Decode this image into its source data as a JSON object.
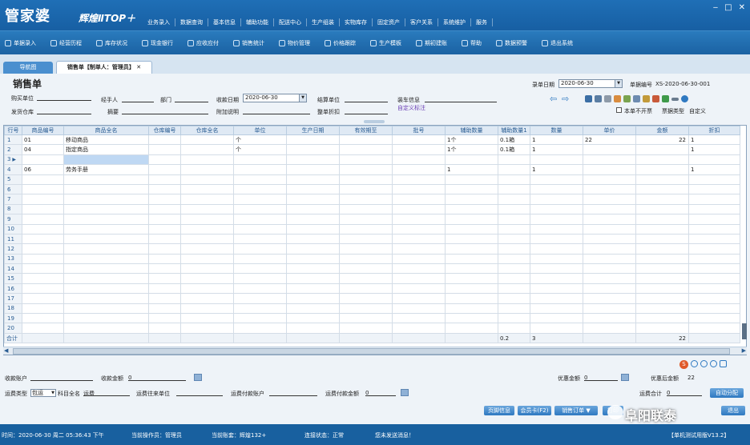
{
  "app": {
    "logo": "管家婆",
    "edition": "辉煌ⅡTOP＋",
    "top_menu": [
      "业务录入",
      "数据查询",
      "基本信息",
      "辅助功能",
      "配送中心",
      "生产组装",
      "实物库存",
      "固定资产",
      "客户关系",
      "系统维护",
      "服务"
    ],
    "window_controls": [
      "‒",
      "□",
      "✕"
    ]
  },
  "toolbar": [
    {
      "label": "单据录入",
      "icon": "doc-icon"
    },
    {
      "label": "经营历程",
      "icon": "chart-icon"
    },
    {
      "label": "库存状况",
      "icon": "box-icon"
    },
    {
      "label": "现金银行",
      "icon": "bank-icon"
    },
    {
      "label": "应收应付",
      "icon": "money-icon"
    },
    {
      "label": "销售统计",
      "icon": "search-icon"
    },
    {
      "label": "物价管理",
      "icon": "gear-icon"
    },
    {
      "label": "价格跟踪",
      "icon": "track-icon"
    },
    {
      "label": "生产模板",
      "icon": "wrench-icon"
    },
    {
      "label": "期初建账",
      "icon": "book-icon"
    },
    {
      "label": "帮助",
      "icon": "help-icon"
    },
    {
      "label": "数据预警",
      "icon": "alert-icon"
    },
    {
      "label": "退出系统",
      "icon": "power-icon"
    }
  ],
  "tabs": {
    "nav": "导航图",
    "doc": "销售单【制单人：管理员】",
    "close": "✕"
  },
  "form": {
    "title": "销售单",
    "record_date_label": "录单日期",
    "record_date": "2020-06-30",
    "doc_no_label": "单据编号",
    "doc_no": "XS-2020-06-30-001",
    "buyer_label": "购买单位",
    "handler_label": "经手人",
    "dept_label": "部门",
    "pay_date_label": "收款日期",
    "pay_date": "2020-06-30",
    "settle_label": "结算单位",
    "loading_label": "装车信息",
    "warehouse_label": "发货仓库",
    "summary_label": "摘要",
    "note_label": "附加说明",
    "discount_label": "整单折扣",
    "custom_link": "自定义标注",
    "no_print_label": "本单不开票",
    "type_label": "票据类型",
    "custom_label": "自定义"
  },
  "grid": {
    "columns": [
      "行号",
      "商品编号",
      "商品全名",
      "仓库编号",
      "仓库全名",
      "单位",
      "生产日期",
      "有效期至",
      "批号",
      "辅助数量",
      "辅助数量1",
      "数量",
      "单价",
      "金额",
      "折扣"
    ],
    "rows": [
      [
        "1",
        "01",
        "移动商品",
        "",
        "",
        "个",
        "",
        "",
        "",
        "1个",
        "0.1箱",
        "1",
        "22",
        "22",
        "1"
      ],
      [
        "2",
        "04",
        "指定商品",
        "",
        "",
        "个",
        "",
        "",
        "",
        "1个",
        "0.1箱",
        "1",
        "",
        "",
        "1"
      ],
      [
        "3",
        "",
        "",
        "",
        "",
        "",
        "",
        "",
        "",
        "",
        "",
        "",
        "",
        "",
        ""
      ],
      [
        "4",
        "06",
        "劳务手册",
        "",
        "",
        "",
        "",
        "",
        "",
        "1",
        "",
        "1",
        "",
        "",
        "1"
      ],
      [
        "5"
      ],
      [
        "6"
      ],
      [
        "7"
      ],
      [
        "8"
      ],
      [
        "9"
      ],
      [
        "10"
      ],
      [
        "11"
      ],
      [
        "12"
      ],
      [
        "13"
      ],
      [
        "14"
      ],
      [
        "15"
      ],
      [
        "16"
      ],
      [
        "17"
      ],
      [
        "18"
      ],
      [
        "19"
      ],
      [
        "20"
      ]
    ],
    "total_label": "合计",
    "total_aux1": "0.2",
    "total_qty": "3",
    "total_amount": "22"
  },
  "bottom": {
    "account_label": "收款账户",
    "amount_label": "收款金额",
    "amount": "0",
    "discount_amount_label": "优惠金额",
    "discount_amount": "0",
    "after_discount_label": "优惠后金额",
    "after_discount": "22",
    "freight_type_label": "运费类型",
    "freight_type": "包运",
    "subject_label": "科目全名",
    "subject": "运费",
    "freight_unit_label": "运费往来单位",
    "freight_account_label": "运费付款账户",
    "freight_pay_label": "运费付款金额",
    "freight_pay": "0",
    "freight_total_label": "运费合计",
    "freight_total": "0",
    "auto_alloc": "自动分配",
    "buttons": [
      "页脚信息",
      "会员卡(F2)",
      "销售订单 ▼",
      "打印",
      "退出"
    ]
  },
  "status": {
    "time": "时间：2020-06-30 周二 05:36:43 下午",
    "operator": "当前操作员：管理员",
    "account": "当前账套：辉煌132+",
    "conn": "连接状态：正常",
    "msg": "您未发送消息！",
    "version": "【单机测试用版V13.2】",
    "watermark": "阜阳联泰"
  }
}
